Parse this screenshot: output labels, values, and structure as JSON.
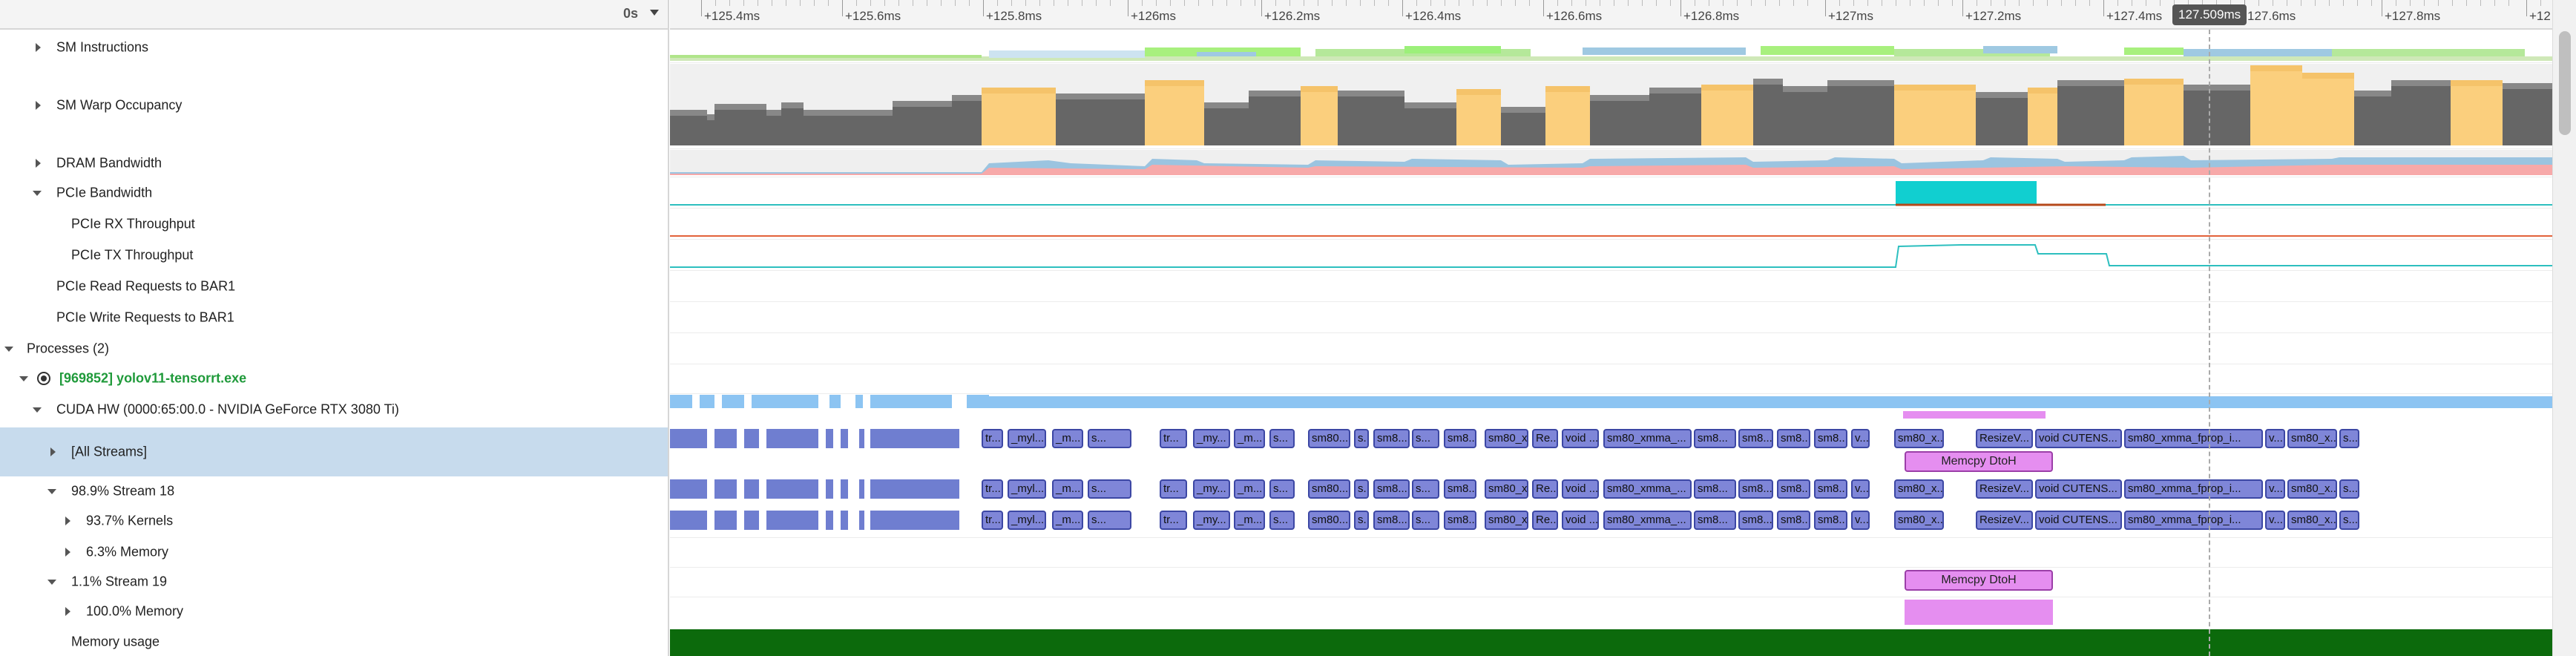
{
  "timeline_header": {
    "start_time": "0s"
  },
  "ruler": {
    "ticks": [
      "+125.4ms",
      "+125.6ms",
      "+125.8ms",
      "+126ms",
      "+126.2ms",
      "+126.4ms",
      "+126.6ms",
      "+126.8ms",
      "+127ms",
      "+127.2ms",
      "+127.4ms",
      "127.6ms",
      "+127.8ms",
      "+12"
    ],
    "cursor_time": "127.509ms"
  },
  "tree_rows": [
    {
      "label": "SM Instructions",
      "arrow": "right"
    },
    {
      "label": "SM Warp Occupancy",
      "arrow": "right"
    },
    {
      "label": "DRAM Bandwidth",
      "arrow": "right"
    },
    {
      "label": "PCIe Bandwidth",
      "arrow": "down"
    },
    {
      "label": "PCIe RX Throughput",
      "arrow": "none"
    },
    {
      "label": "PCIe TX Throughput",
      "arrow": "none"
    },
    {
      "label": "PCIe Read Requests to BAR1",
      "arrow": "none"
    },
    {
      "label": "PCIe Write Requests to BAR1",
      "arrow": "none"
    },
    {
      "label": "Processes (2)",
      "arrow": "down"
    },
    {
      "label": "[969852] yolov11-tensorrt.exe",
      "arrow": "down"
    },
    {
      "label": "CUDA HW (0000:65:00.0 - NVIDIA GeForce RTX 3080 Ti)",
      "arrow": "down"
    },
    {
      "label": "[All Streams]",
      "arrow": "right"
    },
    {
      "label": "98.9% Stream 18",
      "arrow": "down"
    },
    {
      "label": "93.7% Kernels",
      "arrow": "right"
    },
    {
      "label": "6.3% Memory",
      "arrow": "right"
    },
    {
      "label": "1.1% Stream 19",
      "arrow": "down"
    },
    {
      "label": "100.0% Memory",
      "arrow": "right"
    },
    {
      "label": "Memory usage",
      "arrow": "none"
    }
  ],
  "kernel_labels": [
    "tr...",
    "_myl...",
    "_m...",
    "s...",
    "tr...",
    "_my...",
    "_m...",
    "s...",
    "sm80...",
    "s...",
    "sm8...",
    "s...",
    "sm8...",
    "sm80_x...",
    "Re...",
    "void ...",
    "sm80_xmma_...",
    "sm8...",
    "sm8...",
    "sm8...",
    "sm8...",
    "v...",
    "sm80_x...",
    "ResizeV...",
    "void CUTENS...",
    "sm80_xmma_fprop_i...",
    "v...",
    "sm80_x...",
    "s..."
  ],
  "memcpy": {
    "all_streams": "Memcpy DtoH",
    "stream19": "Memcpy DtoH"
  },
  "colors": {
    "occupancy_gray": "#666666",
    "occupancy_orange": "#fbcf7d",
    "pcie_rx": "#11cfd0",
    "pcie_line": "#2dbfbf",
    "kernel": "#7f86d8",
    "memcpy": "#e58ef0",
    "memory_usage": "#0c6a0c",
    "process_label": "#1f9a3a"
  }
}
